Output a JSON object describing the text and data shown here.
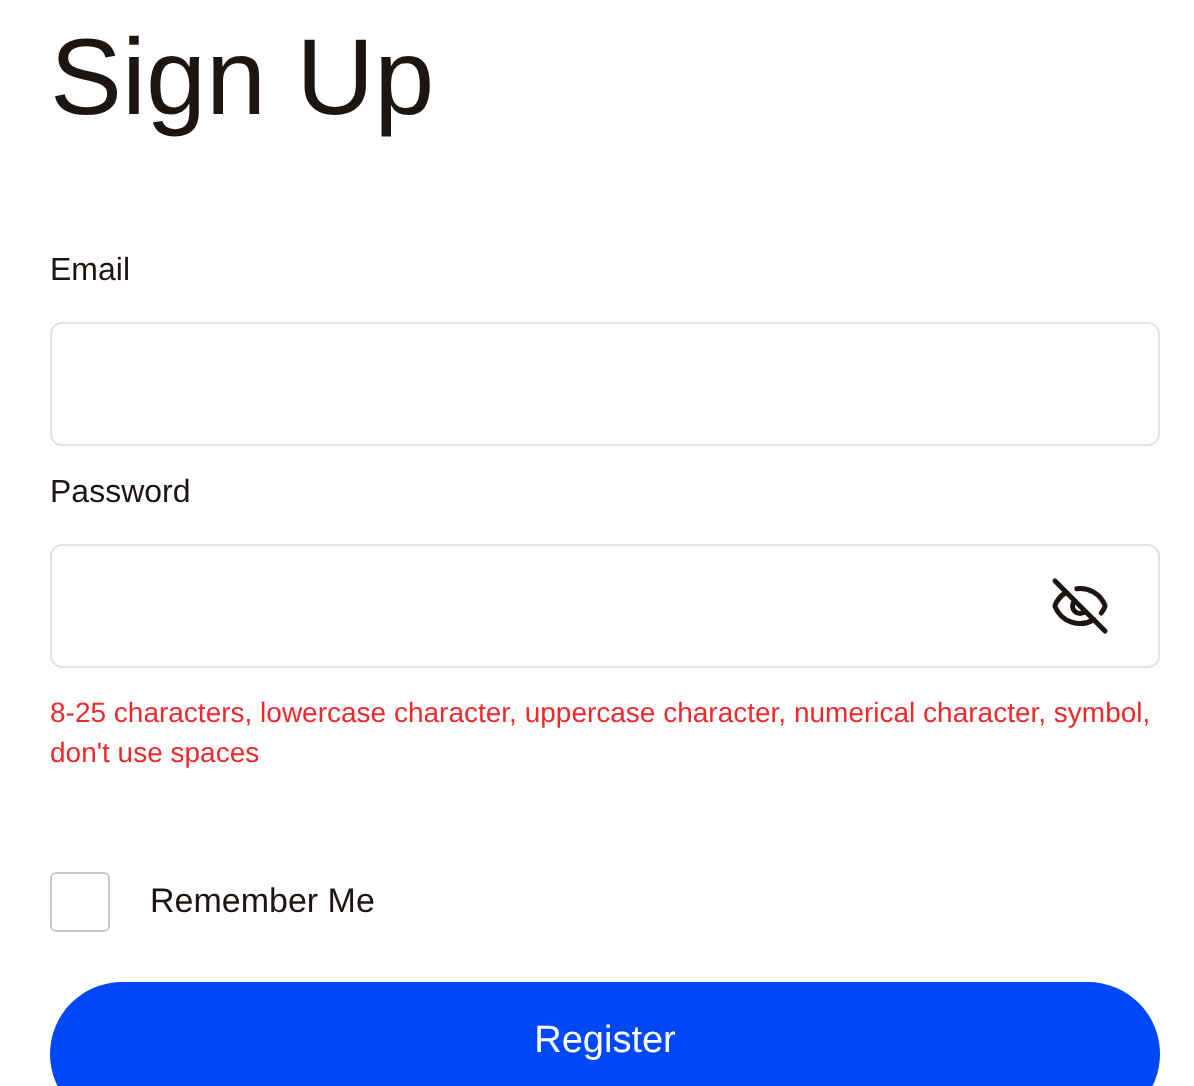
{
  "title": "Sign Up",
  "fields": [
    {
      "label": "Email",
      "kind": "email"
    },
    {
      "label": "Password",
      "kind": "password"
    }
  ],
  "hint": "8-25 characters, lowercase character, uppercase character, numerical character, symbol, don't use spaces",
  "remember": {
    "label": "Remember Me",
    "checked": false
  },
  "submit": "Register"
}
